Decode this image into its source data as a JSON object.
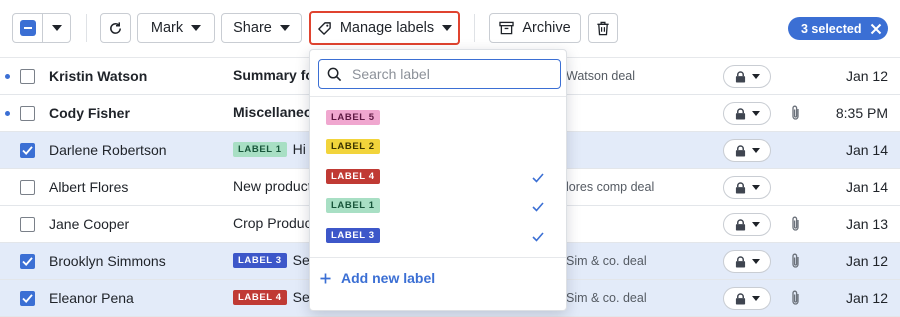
{
  "toolbar": {
    "mark_label": "Mark",
    "share_label": "Share",
    "manage_labels_label": "Manage labels",
    "archive_label": "Archive",
    "selected_label": "3 selected"
  },
  "label_dropdown": {
    "search_placeholder": "Search label",
    "items": [
      {
        "text": "LABEL 5",
        "checked": false
      },
      {
        "text": "LABEL 2",
        "checked": false
      },
      {
        "text": "LABEL 4",
        "checked": true
      },
      {
        "text": "LABEL 1",
        "checked": true
      },
      {
        "text": "LABEL 3",
        "checked": true
      }
    ],
    "add_label": "Add new label"
  },
  "rows": [
    {
      "name": "Kristin Watson",
      "subject": "Summary fo",
      "tail": "Watson deal",
      "date": "Jan 12",
      "unread": true,
      "selected": false,
      "attachment": false
    },
    {
      "name": "Cody Fisher",
      "subject": "Miscellaneou",
      "tail": "",
      "date": "8:35 PM",
      "unread": true,
      "selected": false,
      "attachment": true
    },
    {
      "name": "Darlene Robertson",
      "label": "LABEL 1",
      "subject": "Hi th",
      "tail": "",
      "date": "Jan 14",
      "unread": false,
      "selected": true,
      "attachment": false
    },
    {
      "name": "Albert Flores",
      "subject": "New product",
      "tail": "lores comp deal",
      "date": "Jan 14",
      "unread": false,
      "selected": false,
      "attachment": false
    },
    {
      "name": "Jane Cooper",
      "subject": "Crop Produc",
      "tail": "",
      "date": "Jan 13",
      "unread": false,
      "selected": false,
      "attachment": true
    },
    {
      "name": "Brooklyn Simmons",
      "label": "LABEL 3",
      "subject": "Set",
      "tail": "Sim & co. deal",
      "date": "Jan 12",
      "unread": false,
      "selected": true,
      "attachment": true
    },
    {
      "name": "Eleanor Pena",
      "label": "LABEL 4",
      "subject": "Set",
      "tail": "Sim & co. deal",
      "date": "Jan 12",
      "unread": false,
      "selected": true,
      "attachment": true
    }
  ],
  "colors": {
    "accent": "#3b6fd4",
    "highlight_border": "#e0432f",
    "selected_row": "#e3ebf9"
  }
}
